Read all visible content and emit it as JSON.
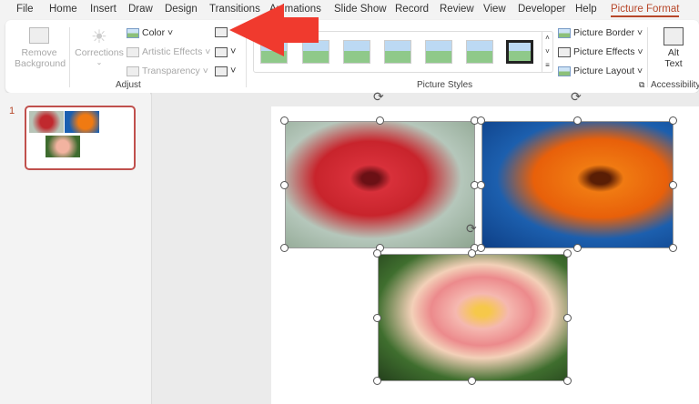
{
  "tabs": [
    "File",
    "Home",
    "Insert",
    "Draw",
    "Design",
    "Transitions",
    "Animations",
    "Slide Show",
    "Record",
    "Review",
    "View",
    "Developer",
    "Help",
    "Picture Format"
  ],
  "active_tab": "Picture Format",
  "ribbon": {
    "remove_bg": [
      "Remove",
      "Background"
    ],
    "corrections": "Corrections",
    "color": "Color",
    "artistic": "Artistic Effects",
    "transparency": "Transparency",
    "adjust_label": "Adjust",
    "styles_label": "Picture Styles",
    "border": "Picture Border",
    "effects": "Picture Effects",
    "layout": "Picture Layout",
    "alt": [
      "Alt",
      "Text"
    ],
    "accessibility_label": "Accessibility"
  },
  "slides": {
    "number": "1"
  },
  "colors": {
    "accent": "#b7472a",
    "arrow": "#f03a2e"
  }
}
